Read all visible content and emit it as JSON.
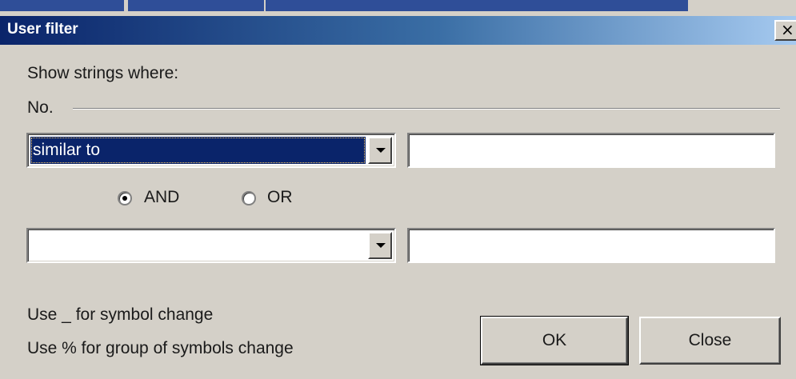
{
  "window": {
    "title": "User filter",
    "close_glyph": "×",
    "close_icon": "close-icon"
  },
  "filter": {
    "prompt": "Show strings where:",
    "field_group_label": "No.",
    "condition1": {
      "operator": "similar to",
      "value": ""
    },
    "logic": {
      "and_label": "AND",
      "or_label": "OR",
      "selected": "AND"
    },
    "condition2": {
      "operator": "",
      "value": ""
    }
  },
  "hints": {
    "underscore": "Use _ for symbol change",
    "percent": "Use % for group of symbols change"
  },
  "buttons": {
    "ok": "OK",
    "close": "Close"
  },
  "colors": {
    "titlebar_start": "#0a246a",
    "titlebar_end": "#a6caf0",
    "face": "#d4d0c8",
    "selection": "#0a246a"
  }
}
